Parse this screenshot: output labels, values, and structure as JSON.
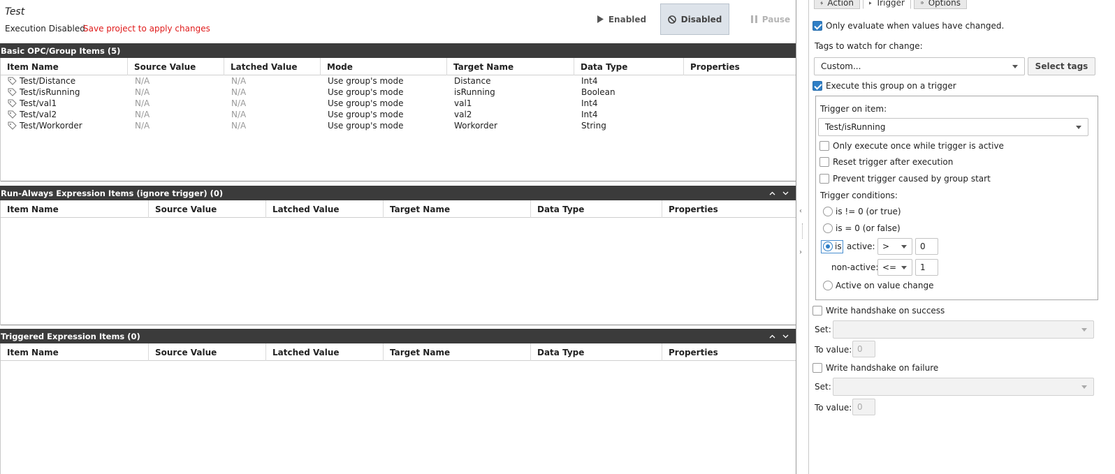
{
  "header": {
    "title": "Test",
    "exec_status": "Execution Disabled",
    "save_warning": "Save project to apply changes",
    "enabled_label": "Enabled",
    "disabled_label": "Disabled",
    "pause_label": "Pause"
  },
  "basic": {
    "title": "Basic OPC/Group Items (5)",
    "columns": [
      "Item Name",
      "Source Value",
      "Latched Value",
      "Mode",
      "Target Name",
      "Data Type",
      "Properties"
    ],
    "rows": [
      {
        "item": "Test/Distance",
        "source": "N/A",
        "latched": "N/A",
        "mode": "Use group's mode",
        "target": "Distance",
        "type": "Int4",
        "props": ""
      },
      {
        "item": "Test/isRunning",
        "source": "N/A",
        "latched": "N/A",
        "mode": "Use group's mode",
        "target": "isRunning",
        "type": "Boolean",
        "props": ""
      },
      {
        "item": "Test/val1",
        "source": "N/A",
        "latched": "N/A",
        "mode": "Use group's mode",
        "target": "val1",
        "type": "Int4",
        "props": ""
      },
      {
        "item": "Test/val2",
        "source": "N/A",
        "latched": "N/A",
        "mode": "Use group's mode",
        "target": "val2",
        "type": "Int4",
        "props": ""
      },
      {
        "item": "Test/Workorder",
        "source": "N/A",
        "latched": "N/A",
        "mode": "Use group's mode",
        "target": "Workorder",
        "type": "String",
        "props": ""
      }
    ]
  },
  "run_always": {
    "title": "Run-Always Expression Items (ignore trigger) (0)",
    "columns": [
      "Item Name",
      "Source Value",
      "Latched Value",
      "Target Name",
      "Data Type",
      "Properties"
    ]
  },
  "triggered": {
    "title": "Triggered Expression Items (0)",
    "columns": [
      "Item Name",
      "Source Value",
      "Latched Value",
      "Target Name",
      "Data Type",
      "Properties"
    ]
  },
  "icons": {
    "tag": "tag-icon",
    "collapse_up": "chevron-up-icon",
    "collapse_down": "chevron-down-icon",
    "action": "lightning-icon",
    "trigger": "play-icon",
    "options": "gear-icon"
  },
  "panel": {
    "tabs": [
      "Action",
      "Trigger",
      "Options"
    ],
    "active_tab": "Trigger",
    "only_evaluate": {
      "label": "Only evaluate when values have changed.",
      "checked": true
    },
    "tags_watch_label": "Tags to watch for change:",
    "tags_watch_value": "Custom...",
    "select_tags_label": "Select tags",
    "execute_trigger": {
      "label": "Execute this group on a trigger",
      "checked": true
    },
    "trigger_item_label": "Trigger on item:",
    "trigger_item_value": "Test/isRunning",
    "once_active": {
      "label": "Only execute once while trigger is active",
      "checked": false
    },
    "reset_after": {
      "label": "Reset trigger after execution",
      "checked": false
    },
    "prevent_start": {
      "label": "Prevent trigger caused by group start",
      "checked": false
    },
    "conditions_label": "Trigger conditions:",
    "cond_true": "is != 0 (or true)",
    "cond_false": "is = 0 (or false)",
    "cond_is": "is",
    "active_label": "active:",
    "active_op": ">",
    "active_value": "0",
    "nonactive_label": "non-active:",
    "nonactive_op": "<=",
    "nonactive_value": "1",
    "cond_change": "Active on value change",
    "selected_condition": "is",
    "handshake_success": {
      "label": "Write handshake on success",
      "checked": false
    },
    "handshake_failure": {
      "label": "Write handshake on failure",
      "checked": false
    },
    "set_label": "Set:",
    "to_value_label": "To value:",
    "to_value_placeholder": "0"
  },
  "colors": {
    "section_header": "#3b3b3b",
    "accent": "#2f7fc6",
    "warning": "#e01b1b"
  }
}
